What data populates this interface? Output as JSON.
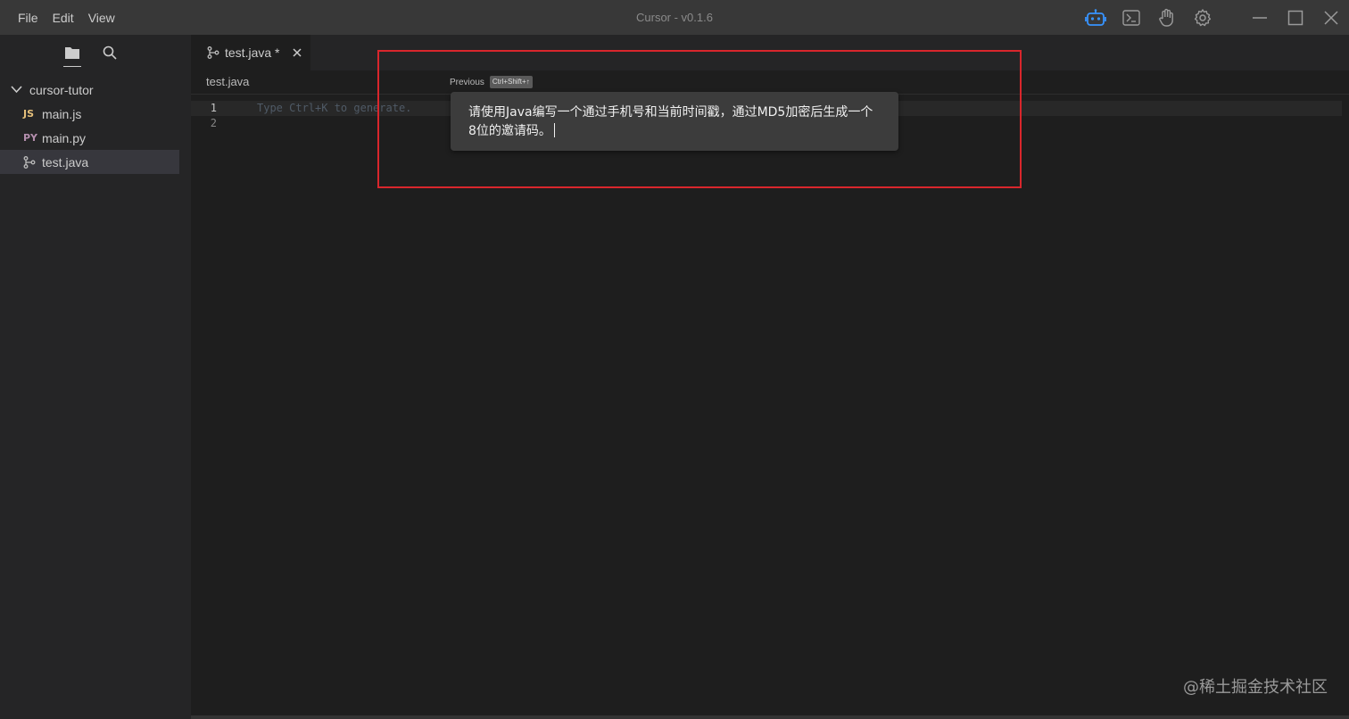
{
  "menu": {
    "file": "File",
    "edit": "Edit",
    "view": "View"
  },
  "app": {
    "title": "Cursor - v0.1.6"
  },
  "title_icons": [
    "robot-icon",
    "terminal-icon",
    "hand-icon",
    "gear-icon"
  ],
  "window_controls": [
    "minimize-icon",
    "maximize-icon",
    "close-icon"
  ],
  "sidebar": {
    "tools": [
      "folder-icon",
      "search-icon"
    ],
    "folder": {
      "name": "cursor-tutor"
    },
    "files": [
      {
        "icon_text": "JS",
        "name": "main.js",
        "color": "#e6c07b"
      },
      {
        "icon_text": "PY",
        "name": "main.py",
        "color": "#b48ead"
      },
      {
        "icon_text": "",
        "name": "test.java",
        "icon": "git-branch-icon"
      }
    ]
  },
  "tab": {
    "label": "test.java *"
  },
  "breadcrumb": {
    "label": "test.java"
  },
  "editor": {
    "lines": [
      "1",
      "2"
    ],
    "hint": "Type Ctrl+K to generate."
  },
  "prompt": {
    "previous_label": "Previous",
    "shortcut": "Ctrl+Shift+↑",
    "text": "请使用Java编写一个通过手机号和当前时间戳，通过MD5加密后生成一个8位的邀请码。"
  },
  "watermark": "@稀土掘金技术社区",
  "colors": {
    "accent": "#3794ff",
    "highlight_border": "#d9262c"
  }
}
